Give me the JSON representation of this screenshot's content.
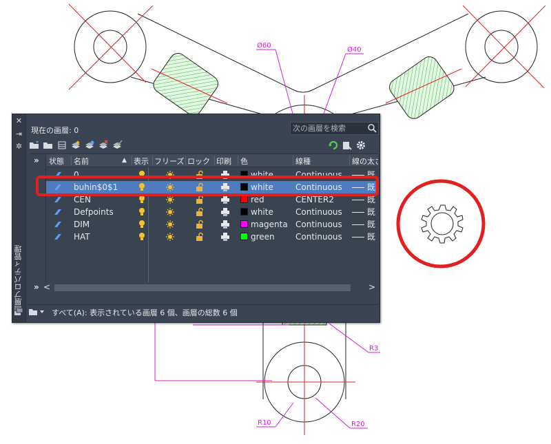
{
  "drawing": {
    "dimensions": {
      "d60": "Ø60",
      "d40": "Ø40",
      "r3": "R3",
      "r10": "R10",
      "r20": "R20"
    },
    "colors": {
      "outline": "#222222",
      "center_line": "#e32020",
      "dimension": "#d81bd8",
      "hatch": "#3db33d",
      "hatch_fill": "#dff5df",
      "highlight": "#e32020"
    }
  },
  "palette": {
    "side_title": "画層プロパティ管理",
    "current_layer": "現在の画層: 0",
    "search": {
      "placeholder": "次の画層を検索"
    },
    "headers": {
      "status": "状態",
      "name": "名前",
      "on": "表示",
      "freeze": "フリーズ",
      "lock": "ロック",
      "plot": "印刷",
      "color": "色",
      "linetype": "線種",
      "lineweight": "線の太さ"
    },
    "layers": [
      {
        "name": "0",
        "color": "white",
        "swatch": "#000000",
        "linetype": "Continuous",
        "lineweight": "既"
      },
      {
        "name": "buhin$0$1",
        "color": "white",
        "swatch": "#000000",
        "linetype": "Continuous",
        "lineweight": "既"
      },
      {
        "name": "CEN",
        "color": "red",
        "swatch": "#ff0000",
        "linetype": "CENTER2",
        "lineweight": "既"
      },
      {
        "name": "Defpoints",
        "color": "white",
        "swatch": "#000000",
        "linetype": "Continuous",
        "lineweight": "既"
      },
      {
        "name": "DIM",
        "color": "magenta",
        "swatch": "#ff00ff",
        "linetype": "Continuous",
        "lineweight": "既"
      },
      {
        "name": "HAT",
        "color": "green",
        "swatch": "#00ff00",
        "linetype": "Continuous",
        "lineweight": "既"
      }
    ],
    "status_text": "すべて(A): 表示されている画層 6 個、画層の総数 6 個",
    "colors": {
      "background": "#3b4453",
      "selected_row": "#4f7cbf",
      "layer_icon": "#5aa0ff",
      "bulb": "#f2c230",
      "sun": "#f2c230",
      "lock": "#f2b130",
      "refresh": "#5cc85c"
    }
  }
}
